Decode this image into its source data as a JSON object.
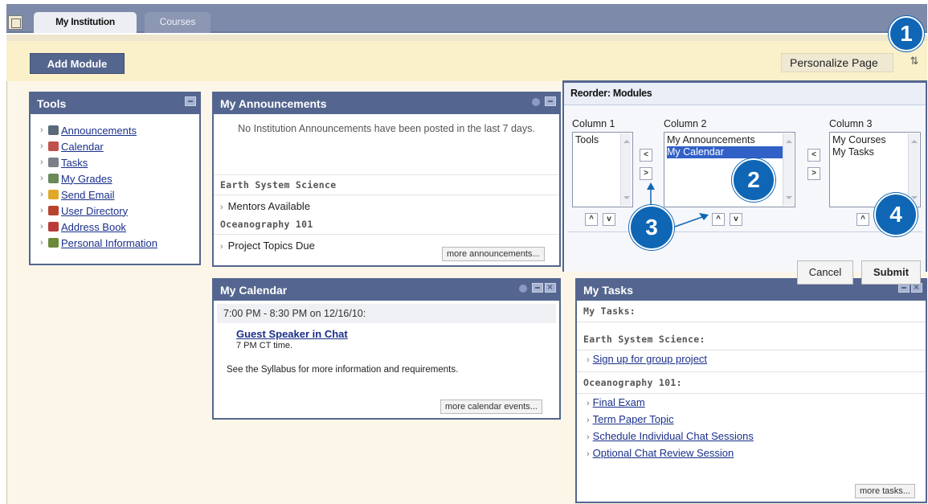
{
  "tabs": {
    "active": "My Institution",
    "other": "Courses"
  },
  "actionbar": {
    "add_module": "Add Module",
    "personalize": "Personalize Page",
    "sort_glyph": "⇅"
  },
  "tools": {
    "title": "Tools",
    "items": [
      {
        "label": "Announcements",
        "icon": "megaphone-icon",
        "color": "#5a6a7a"
      },
      {
        "label": "Calendar",
        "icon": "calendar-icon",
        "color": "#c0524e"
      },
      {
        "label": "Tasks",
        "icon": "tasks-icon",
        "color": "#7a7f88"
      },
      {
        "label": "My Grades",
        "icon": "grades-icon",
        "color": "#6a8a5a"
      },
      {
        "label": "Send Email",
        "icon": "email-icon",
        "color": "#e0a82a"
      },
      {
        "label": "User Directory",
        "icon": "user-directory-icon",
        "color": "#b8432f"
      },
      {
        "label": "Address Book",
        "icon": "address-book-icon",
        "color": "#b83a3a"
      },
      {
        "label": "Personal Information",
        "icon": "personal-info-icon",
        "color": "#6a8a3a"
      }
    ]
  },
  "announcements": {
    "title": "My Announcements",
    "none_text": "No Institution Announcements have been posted in the last 7 days.",
    "courses": [
      {
        "name": "Earth System Science",
        "items": [
          "Mentors Available"
        ]
      },
      {
        "name": "Oceanography 101",
        "items": [
          "Project Topics Due"
        ]
      }
    ],
    "more": "more announcements..."
  },
  "calendar": {
    "title": "My Calendar",
    "date": "7:00 PM - 8:30 PM on 12/16/10:",
    "event_title": "Guest Speaker in Chat",
    "event_desc": "7 PM CT time.",
    "note": "See the Syllabus for more information and requirements.",
    "more": "more calendar events..."
  },
  "tasks": {
    "title": "My Tasks",
    "section_label": "My Tasks:",
    "courses": [
      {
        "name": "Earth System Science:",
        "items": [
          "Sign up for group project"
        ]
      },
      {
        "name": "Oceanography 101:",
        "items": [
          "Final Exam",
          "Term Paper Topic",
          "Schedule Individual Chat Sessions",
          "Optional Chat Review Session"
        ]
      }
    ],
    "more": "more tasks..."
  },
  "reorder": {
    "title": "Reorder: Modules",
    "col1_label": "Column 1",
    "col2_label": "Column 2",
    "col3_label": "Column 3",
    "col1_items": [
      "Tools"
    ],
    "col2_items": [
      "My Announcements",
      "My Calendar"
    ],
    "col2_selected": "My Calendar",
    "col3_items": [
      "My Courses",
      "My Tasks"
    ],
    "cancel": "Cancel",
    "submit": "Submit"
  },
  "callouts": {
    "one": "1",
    "two": "2",
    "three": "3",
    "four": "4"
  },
  "colors": {
    "header": "#54668f",
    "actionbar": "#faf0c9",
    "callout": "#0f66b5",
    "link": "#1a2f8a"
  }
}
